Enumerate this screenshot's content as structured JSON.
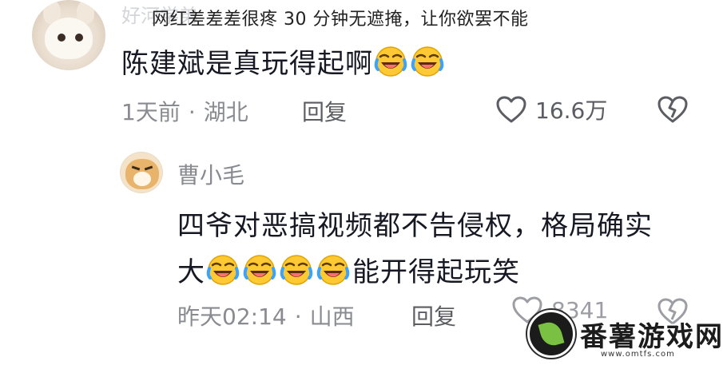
{
  "overlay_caption": "网红差差差很疼 30 分钟无遮掩，让你欲罢不能",
  "main_comment": {
    "faded_username": "好河学弟",
    "text": "陈建斌是真玩得起啊",
    "emoji_count": 2,
    "time": "1天前",
    "location": "湖北",
    "reply_label": "回复",
    "likes": "16.6万"
  },
  "reply_comment": {
    "username": "曹小毛",
    "line1": "四爷对恶搞视频都不告侵权，格局确实",
    "line2_prefix": "大",
    "line2_suffix": "能开得起玩笑",
    "emoji_count": 4,
    "time": "昨天02:14",
    "location": "山西",
    "reply_label": "回复",
    "likes": "8341"
  },
  "separator": "·",
  "watermark": {
    "title": "番薯游戏网",
    "url": "www.omtfs.com",
    "accent_color": "#7ac143"
  },
  "icons": [
    "heart-icon",
    "dislike-heart-icon",
    "laughing-emoji-icon"
  ]
}
